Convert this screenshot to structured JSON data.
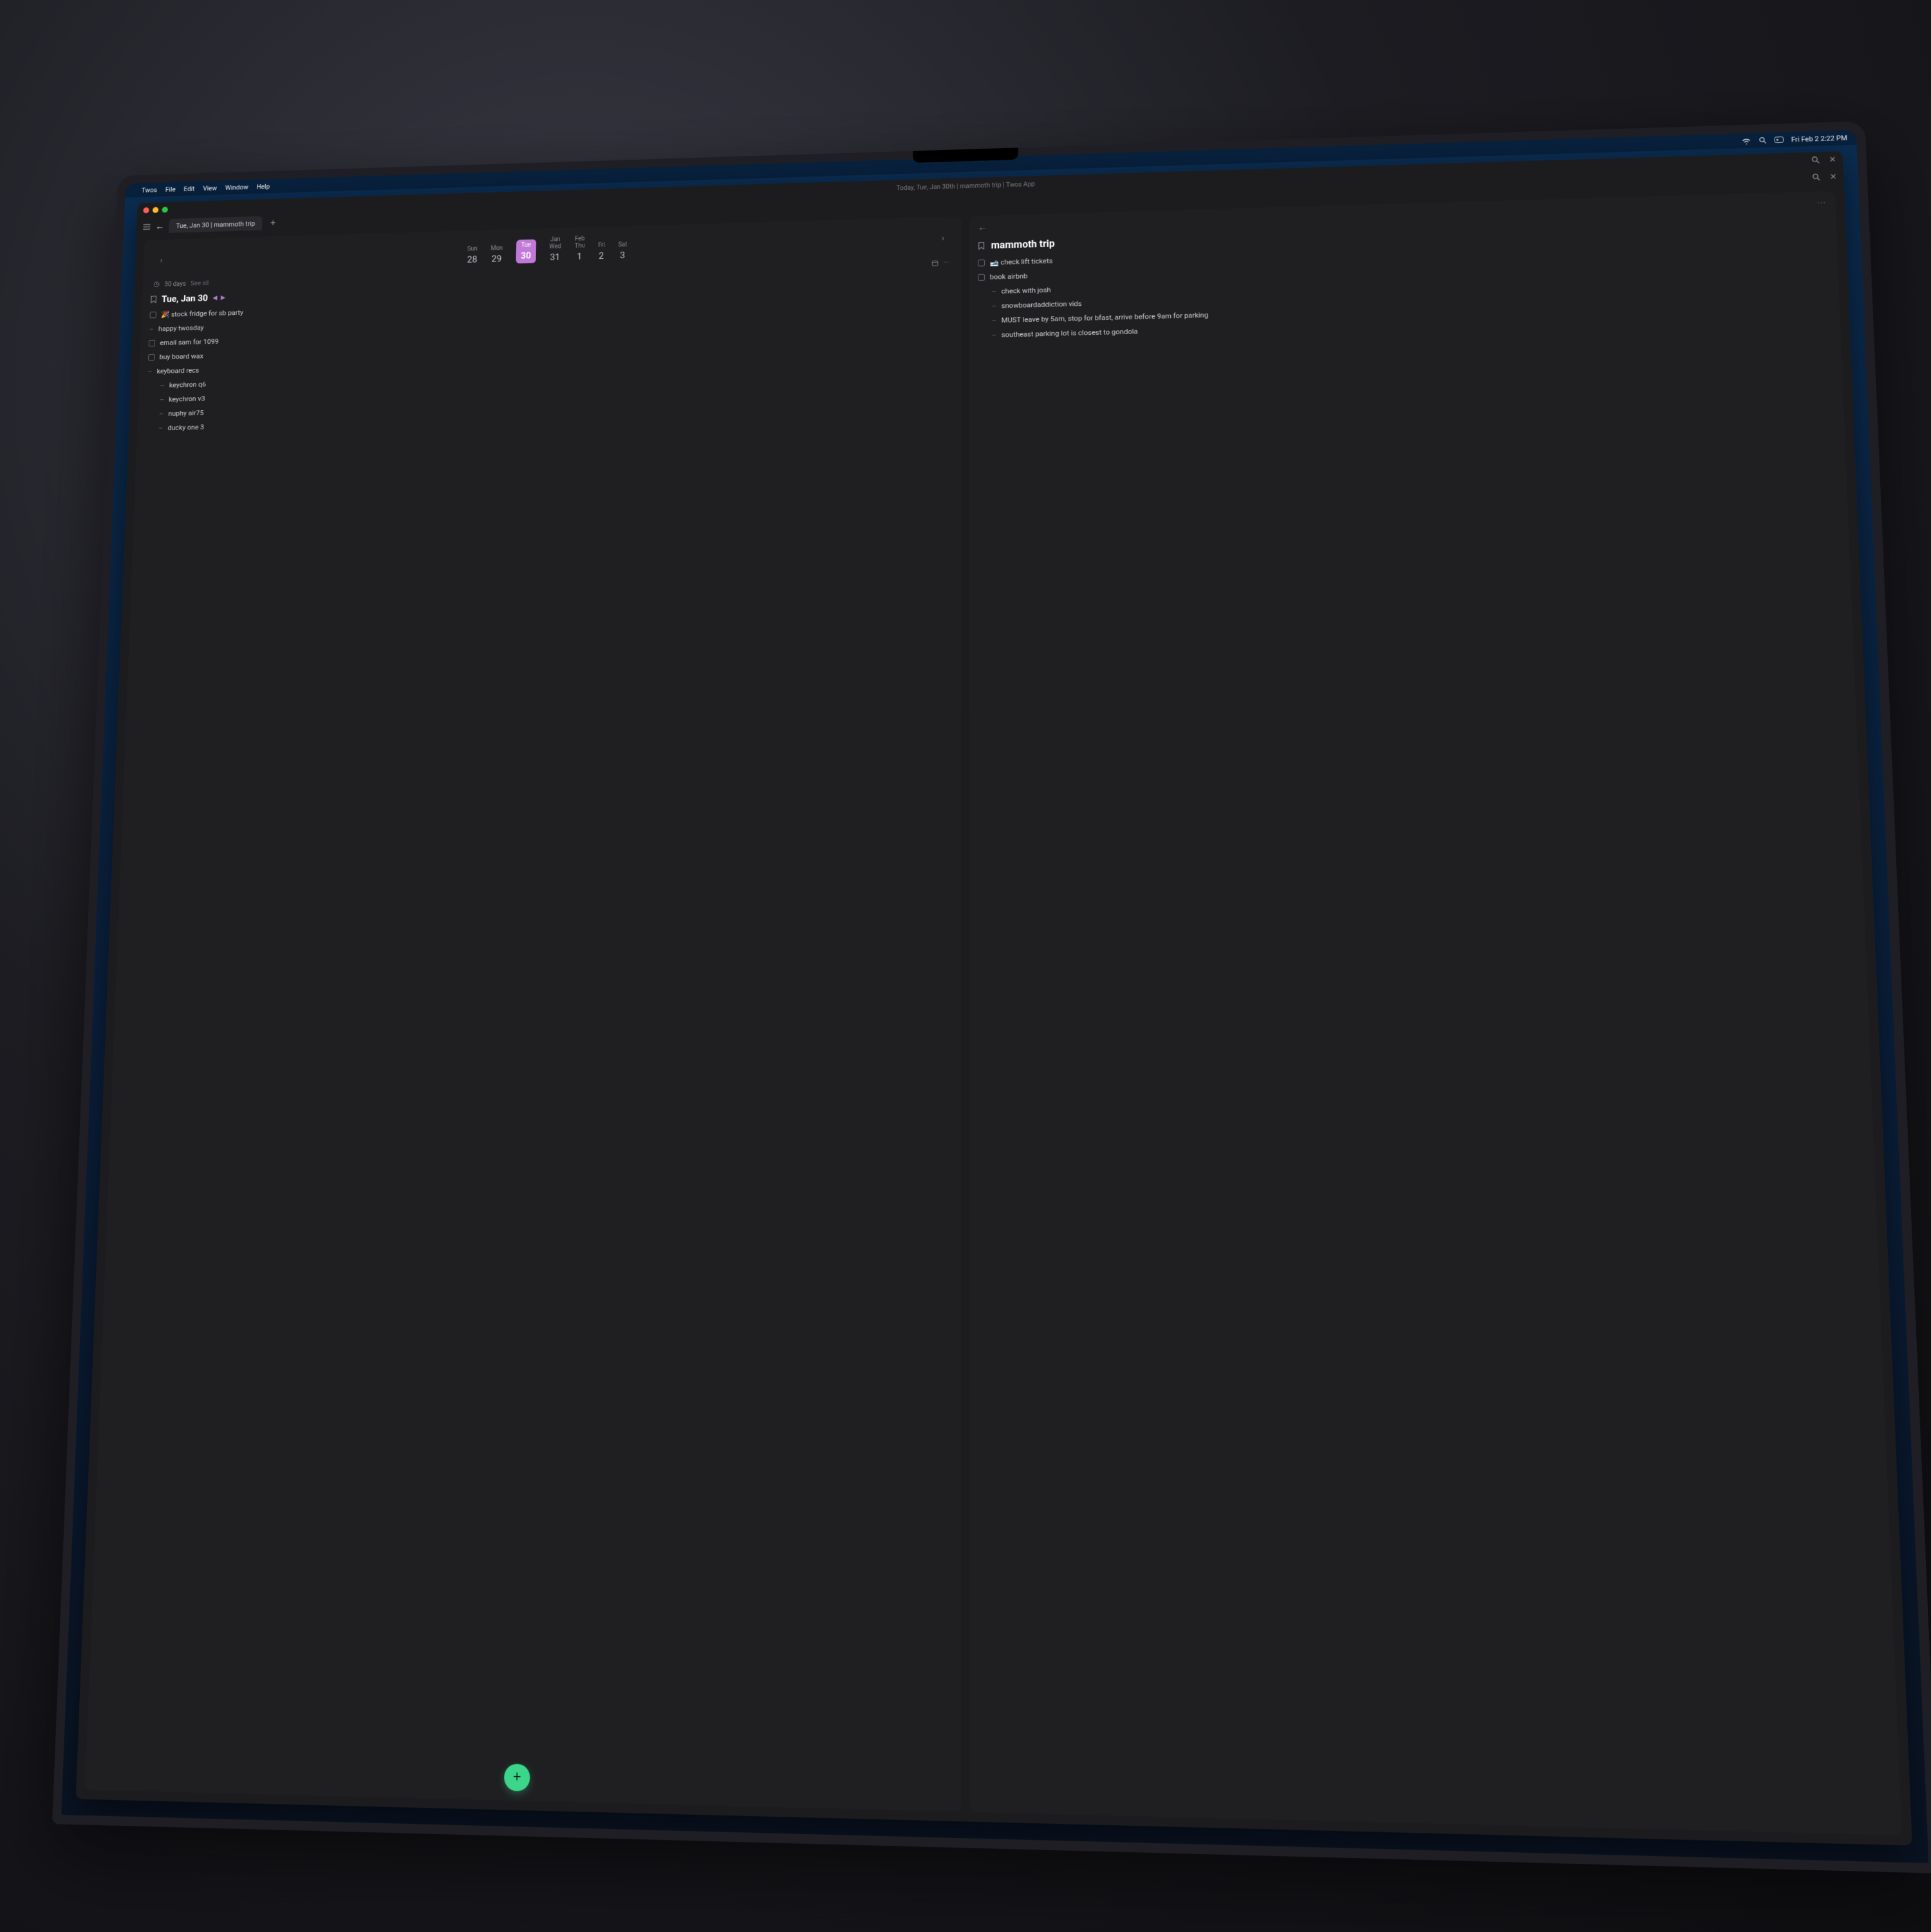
{
  "macos_menu": {
    "app_name": "Twos",
    "items": [
      "File",
      "Edit",
      "View",
      "Window",
      "Help"
    ],
    "clock": "Fri Feb 2  2:22 PM"
  },
  "window": {
    "title": "Today, Tue, Jan 30th | mammoth trip | Twos App"
  },
  "tabs": {
    "main": "Tue, Jan 30 | mammoth trip"
  },
  "left_pane": {
    "calendar": {
      "days": [
        {
          "dow": "Sun",
          "num": "28"
        },
        {
          "dow": "Mon",
          "num": "29"
        },
        {
          "dow": "Tue",
          "num": "30",
          "selected": true
        },
        {
          "dow": "Jan\nWed",
          "num": "31"
        },
        {
          "dow": "Feb\nThu",
          "num": "1"
        },
        {
          "dow": "Fri",
          "num": "2"
        },
        {
          "dow": "Sat",
          "num": "3"
        }
      ]
    },
    "meta": {
      "range": "30 days",
      "see_all": "See all"
    },
    "title": "Tue, Jan 30",
    "items": [
      {
        "type": "todo",
        "text": "🎉 stock fridge for sb party"
      },
      {
        "type": "dash",
        "text": "happy twosday"
      },
      {
        "type": "todo",
        "text": "email sam for 1099"
      },
      {
        "type": "todo",
        "text": "buy board wax"
      },
      {
        "type": "dash",
        "text": "keyboard recs"
      },
      {
        "type": "dash",
        "indent": 1,
        "text": "keychron q6"
      },
      {
        "type": "dash",
        "indent": 1,
        "text": "keychron v3"
      },
      {
        "type": "dash",
        "indent": 1,
        "text": "nuphy air75"
      },
      {
        "type": "dash",
        "indent": 1,
        "text": "ducky one 3"
      }
    ]
  },
  "right_pane": {
    "title": "mammoth trip",
    "items": [
      {
        "type": "todo",
        "text": "🎿 check lift tickets"
      },
      {
        "type": "todo",
        "text": "book airbnb"
      },
      {
        "type": "dash",
        "indent": 1,
        "text": "check with josh"
      },
      {
        "type": "dash",
        "indent": 1,
        "text": "snowboardaddiction vids"
      },
      {
        "type": "dash",
        "indent": 1,
        "text": "MUST leave by 5am, stop for bfast, arrive before 9am for parking"
      },
      {
        "type": "dash",
        "indent": 1,
        "text": "southeast parking lot is closest to gondola"
      }
    ]
  }
}
